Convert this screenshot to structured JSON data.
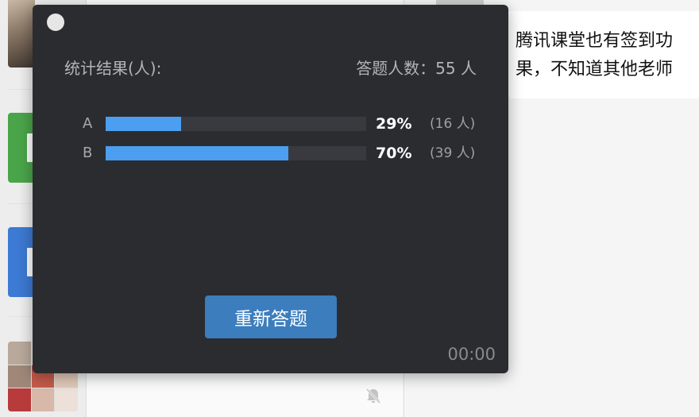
{
  "chat": {
    "message": [
      "腾讯课堂也有签到功",
      "果，不知道其他老师"
    ]
  },
  "popup": {
    "stats_title": "统计结果(人):",
    "answer_count": "答题人数：55 人",
    "results": [
      {
        "option": "A",
        "percent": "29%",
        "count": "(16 人)",
        "fraction": 0.29
      },
      {
        "option": "B",
        "percent": "70%",
        "count": "(39 人)",
        "fraction": 0.7
      }
    ],
    "reanswer_label": "重新答题",
    "timer": "00:00"
  },
  "colors": {
    "popup_bg": "#2b2c30",
    "bar_fill": "#4b9ef0",
    "bar_track": "#393a3f",
    "button_bg": "#3c7dbd",
    "green_tile": "#4aa54a",
    "blue_tile": "#3c7ad3"
  },
  "icons": [
    "close-dot-icon",
    "mute-bell-icon"
  ]
}
